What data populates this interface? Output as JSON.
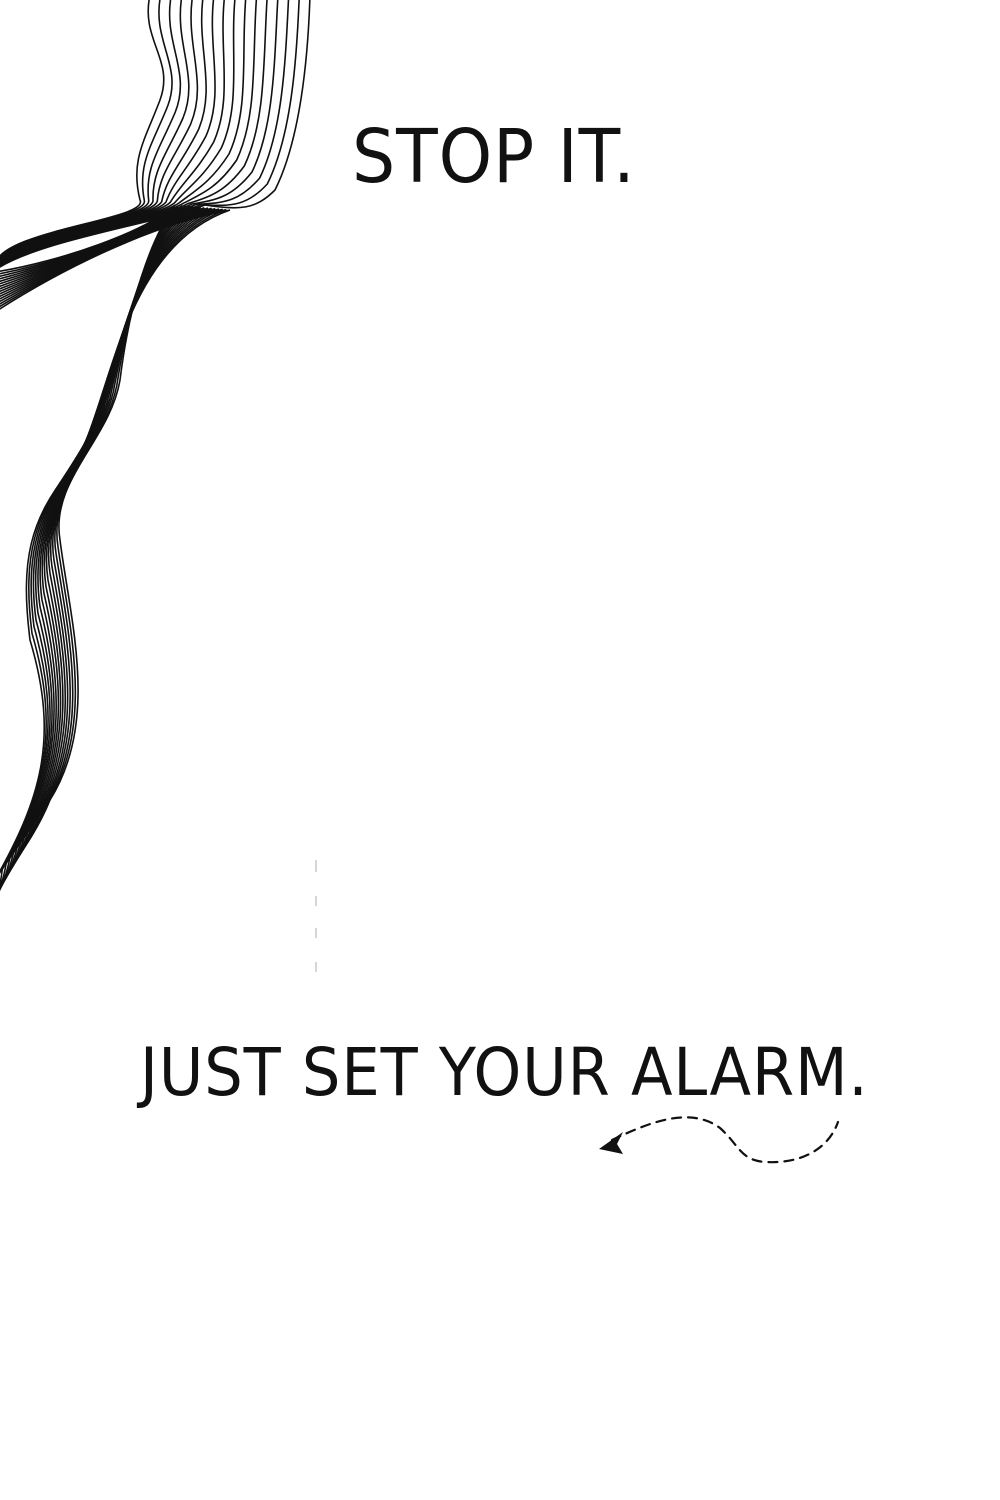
{
  "texts": {
    "top_title": "STOP IT.",
    "bottom_title": "JUST SET YOUR ALARM."
  },
  "colors": {
    "background": "#ffffff",
    "ink": "#111111"
  },
  "icons": {
    "decoration": "wavy-contour-lines",
    "arrow": "dashed-curly-arrow"
  }
}
